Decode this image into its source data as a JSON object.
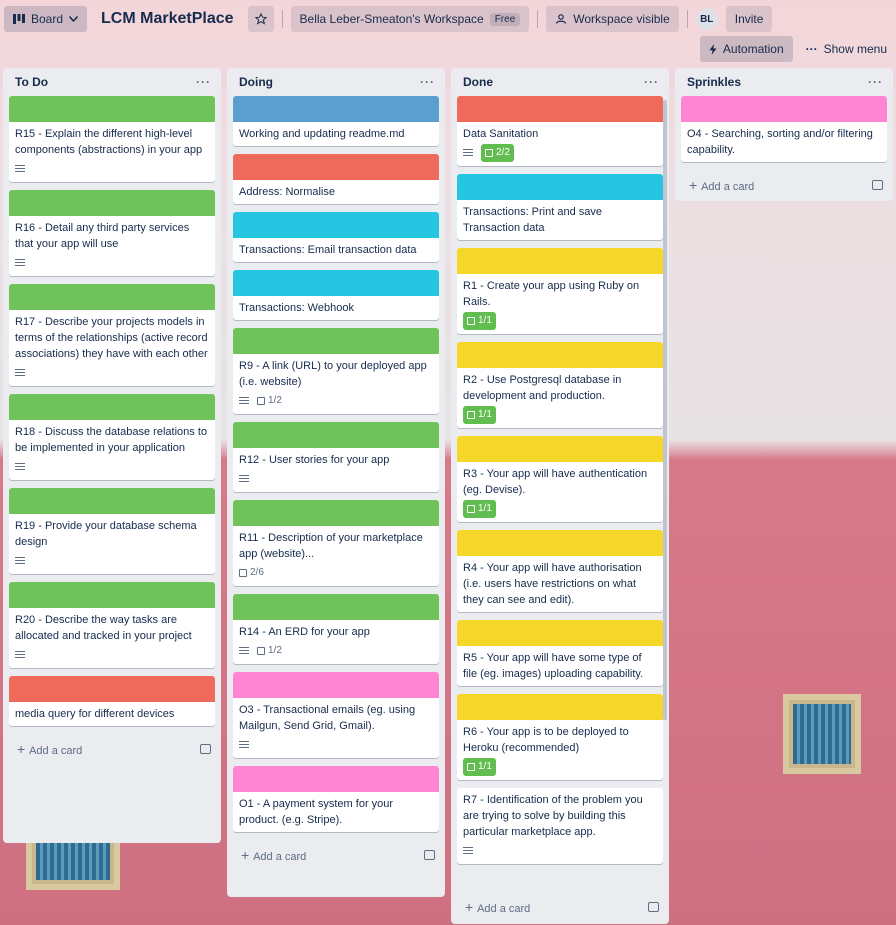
{
  "header": {
    "view_label": "Board",
    "board_title": "LCM MarketPlace",
    "workspace_label": "Bella Leber-Smeaton's Workspace",
    "workspace_badge": "Free",
    "visibility_label": "Workspace visible",
    "avatar_initials": "BL",
    "invite_label": "Invite"
  },
  "subheader": {
    "automation_label": "Automation",
    "show_menu_label": "Show menu"
  },
  "colors": {
    "green": "#70c35a",
    "blue": "#5a9fd0",
    "red": "#ef6a5a",
    "cyan": "#26c6e2",
    "yellow": "#f5d72a",
    "pink": "#ff84d1"
  },
  "lists": [
    {
      "title": "To Do",
      "menu": "···",
      "add_label": "Add a card",
      "cards": [
        {
          "cover": "green",
          "title": "R15 - Explain the different high-level components (abstractions) in your app",
          "desc": true
        },
        {
          "cover": "green",
          "title": "R16 - Detail any third party services that your app will use",
          "desc": true
        },
        {
          "cover": "green",
          "title": "R17 - Describe your projects models in terms of the relationships (active record associations) they have with each other",
          "desc": true
        },
        {
          "cover": "green",
          "title": "R18 - Discuss the database relations to be implemented in your application",
          "desc": true
        },
        {
          "cover": "green",
          "title": "R19 - Provide your database schema design",
          "desc": true
        },
        {
          "cover": "green",
          "title": "R20 - Describe the way tasks are allocated and tracked in your project",
          "desc": true
        },
        {
          "cover": "red",
          "title": "media query for different devices"
        }
      ]
    },
    {
      "title": "Doing",
      "menu": "···",
      "add_label": "Add a card",
      "cards": [
        {
          "cover": "blue",
          "title": "Working and updating readme.md"
        },
        {
          "cover": "red",
          "title": "Address: Normalise"
        },
        {
          "cover": "cyan",
          "title": "Transactions: Email transaction data"
        },
        {
          "cover": "cyan",
          "title": "Transactions: Webhook"
        },
        {
          "cover": "green",
          "title": "R9 - A link (URL) to your deployed app (i.e. website)",
          "desc": true,
          "checklist": "1/2"
        },
        {
          "cover": "green",
          "title": "R12 - User stories for your app",
          "desc": true
        },
        {
          "cover": "green",
          "title": "R11 - Description of your marketplace app (website)...",
          "checklist": "2/6"
        },
        {
          "cover": "green",
          "title": "R14 - An ERD for your app",
          "desc": true,
          "checklist": "1/2"
        },
        {
          "cover": "pink",
          "title": "O3 - Transactional emails (eg. using Mailgun, Send Grid, Gmail).",
          "desc": true
        },
        {
          "cover": "pink",
          "title": "O1 - A payment system for your product. (e.g. Stripe)."
        }
      ]
    },
    {
      "title": "Done",
      "menu": "···",
      "add_label": "Add a card",
      "cards": [
        {
          "cover": "red",
          "title": "Data Sanitation",
          "desc": true,
          "checklist": "2/2",
          "done": true
        },
        {
          "cover": "cyan",
          "title": "Transactions: Print and save Transaction data"
        },
        {
          "cover": "yellow",
          "title": "R1 - Create your app using Ruby on Rails.",
          "checklist": "1/1",
          "done": true
        },
        {
          "cover": "yellow",
          "title": "R2 - Use Postgresql database in development and production.",
          "checklist": "1/1",
          "done": true
        },
        {
          "cover": "yellow",
          "title": "R3 - Your app will have authentication (eg. Devise).",
          "checklist": "1/1",
          "done": true
        },
        {
          "cover": "yellow",
          "title": "R4 - Your app will have authorisation (i.e. users have restrictions on what they can see and edit)."
        },
        {
          "cover": "yellow",
          "title": "R5 - Your app will have some type of file (eg. images) uploading capability."
        },
        {
          "cover": "yellow",
          "title": "R6 - Your app is to be deployed to Heroku (recommended)",
          "checklist": "1/1",
          "done": true
        },
        {
          "cover": "",
          "title": "R7 - Identification of the problem you are trying to solve by building this particular marketplace app.",
          "desc": true
        }
      ]
    },
    {
      "title": "Sprinkles",
      "menu": "···",
      "add_label": "Add a card",
      "cards": [
        {
          "cover": "pink",
          "title": "O4 - Searching, sorting and/or filtering capability."
        }
      ]
    }
  ]
}
